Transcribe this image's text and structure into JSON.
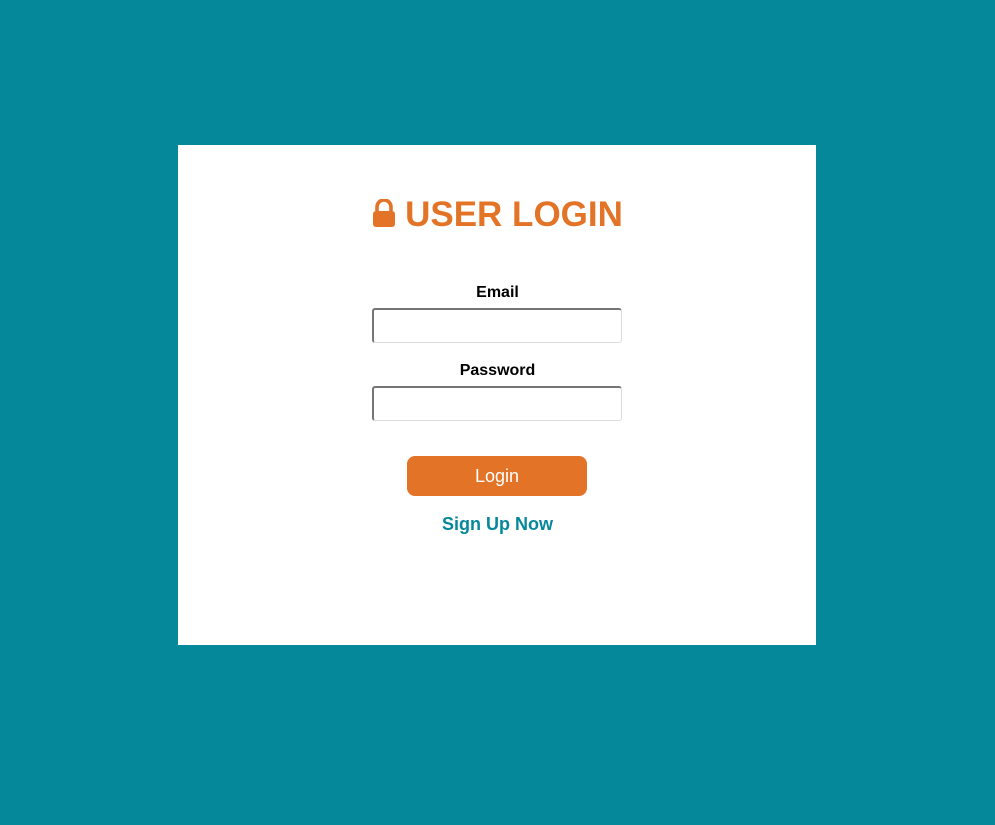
{
  "login_form": {
    "title": "USER LOGIN",
    "title_icon": "lock-icon",
    "email_label": "Email",
    "email_value": "",
    "password_label": "Password",
    "password_value": "",
    "login_button_label": "Login",
    "signup_link_label": "Sign Up Now"
  },
  "colors": {
    "background": "#06889b",
    "card": "#ffffff",
    "accent": "#e37326",
    "link": "#06889b",
    "label_text": "#000000"
  }
}
